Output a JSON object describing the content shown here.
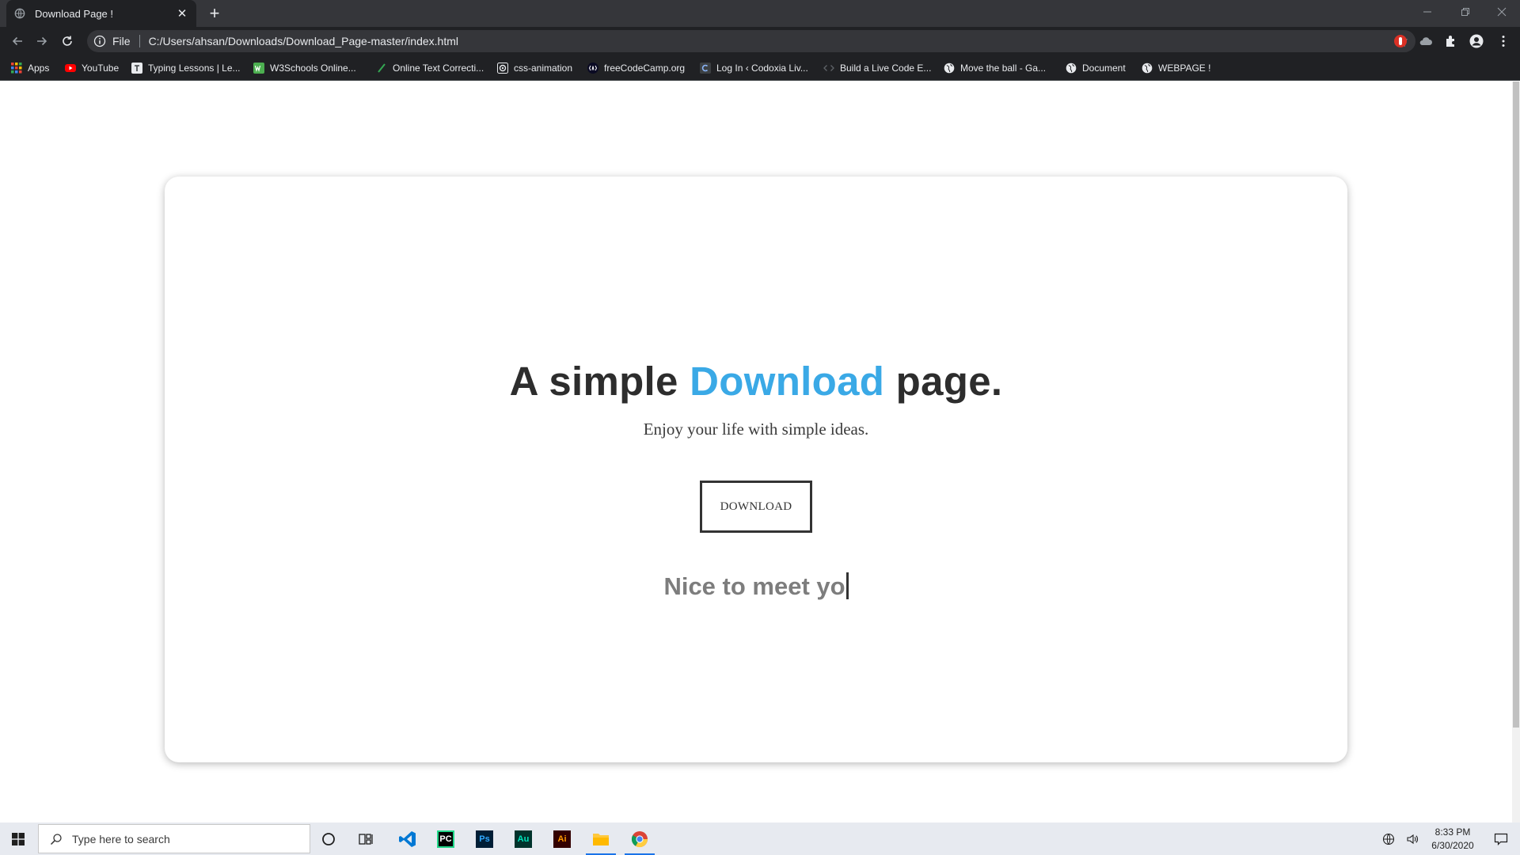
{
  "browser": {
    "tab_title": "Download Page !",
    "url_scheme": "File",
    "url": "C:/Users/ahsan/Downloads/Download_Page-master/index.html"
  },
  "bookmarks": [
    {
      "label": "Apps",
      "icon": "apps-grid-icon",
      "color": "#ea4335"
    },
    {
      "label": "YouTube",
      "icon": "youtube-icon",
      "color": "#ff0000"
    },
    {
      "label": "Typing Lessons | Le...",
      "icon": "typing-icon",
      "color": "#9aa0a6"
    },
    {
      "label": "W3Schools Online...",
      "icon": "w3schools-icon",
      "color": "#4caf50"
    },
    {
      "label": "Online Text Correcti...",
      "icon": "text-correction-icon",
      "color": "#2e7d32"
    },
    {
      "label": "css-animation",
      "icon": "css-animation-icon",
      "color": "#e8eaed"
    },
    {
      "label": "freeCodeCamp.org",
      "icon": "freecodecamp-icon",
      "color": "#0a0a23"
    },
    {
      "label": "Log In ‹ Codoxia Liv...",
      "icon": "codoxia-icon",
      "color": "#5f6368"
    },
    {
      "label": "Build a Live Code E...",
      "icon": "code-icon",
      "color": "#9aa0a6"
    },
    {
      "label": "Move the ball - Ga...",
      "icon": "globe-icon",
      "color": "#e8eaed"
    },
    {
      "label": "Document",
      "icon": "globe-icon",
      "color": "#e8eaed"
    },
    {
      "label": "WEBPAGE !",
      "icon": "globe-icon",
      "color": "#e8eaed"
    }
  ],
  "page": {
    "headline_pre": "A simple ",
    "headline_accent": "Download",
    "headline_post": " page.",
    "subtitle": "Enjoy your life with simple ideas.",
    "download_label": "DOWNLOAD",
    "typing_text": "Nice to meet yo",
    "accent_color": "#3aa9e6"
  },
  "taskbar": {
    "search_placeholder": "Type here to search",
    "apps": [
      "cortana-icon",
      "task-view-icon",
      "vscode-icon",
      "pycharm-icon",
      "photoshop-icon",
      "audition-icon",
      "illustrator-icon",
      "file-explorer-icon",
      "chrome-icon"
    ],
    "pycharm_label": "PC",
    "photoshop_label": "Ps",
    "audition_label": "Au",
    "illustrator_label": "Ai",
    "time": "8:33 PM",
    "date": "6/30/2020"
  }
}
